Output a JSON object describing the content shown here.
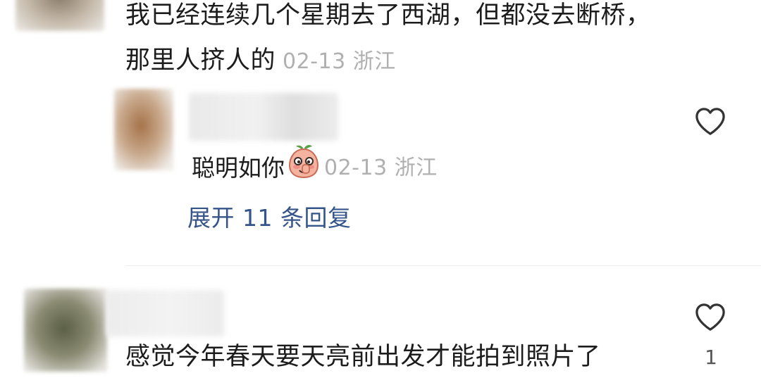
{
  "comments": [
    {
      "text": "我已经连续几个星期去了西湖，但都没去断桥，那里人挤人的",
      "date": "02-13",
      "location": "浙江"
    },
    {
      "text": "感觉今年春天要天亮前出发才能拍到照片了",
      "like_count": "1"
    }
  ],
  "reply": {
    "text": "聪明如你",
    "emoji": "shy-peach-emoji",
    "date": "02-13",
    "location": "浙江"
  },
  "expand_label": "展开 11 条回复",
  "icons": {
    "like": "heart-outline-icon"
  },
  "colors": {
    "text": "#1c1c1c",
    "meta": "#b0b0b0",
    "link": "#35548a",
    "divider": "#ebebeb"
  }
}
